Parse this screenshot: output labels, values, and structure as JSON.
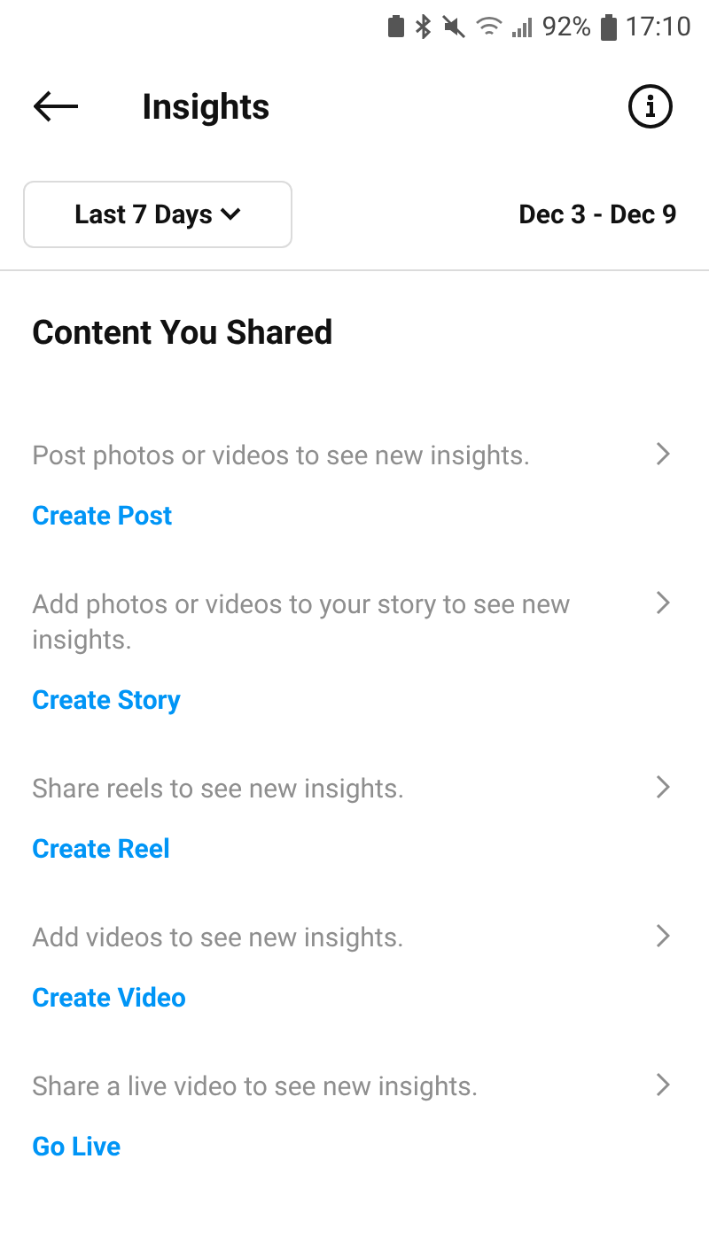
{
  "status_bar": {
    "battery": "92%",
    "time": "17:10"
  },
  "header": {
    "title": "Insights"
  },
  "filter": {
    "range": "Last 7 Days",
    "dates": "Dec 3 - Dec 9"
  },
  "section": {
    "title": "Content You Shared"
  },
  "items": [
    {
      "text": "Post photos or videos to see new insights.",
      "action": "Create Post"
    },
    {
      "text": "Add photos or videos to your story to see new insights.",
      "action": "Create Story"
    },
    {
      "text": "Share reels to see new insights.",
      "action": "Create Reel"
    },
    {
      "text": "Add videos to see new insights.",
      "action": "Create Video"
    },
    {
      "text": "Share a live video to see new insights.",
      "action": "Go Live"
    }
  ]
}
